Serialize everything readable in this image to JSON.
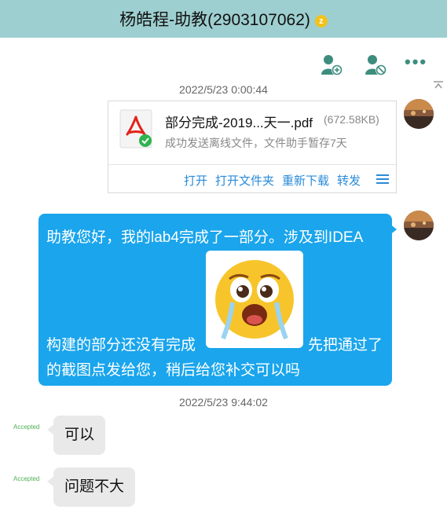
{
  "header": {
    "title": "杨皓程-助教(2903107062)",
    "badge_letter": "z",
    "background_color": "#9ecfd0"
  },
  "toolbar": {
    "icons": [
      "add-contact-icon",
      "block-contact-icon",
      "more-icon"
    ],
    "more_glyph": "•••"
  },
  "messages": [
    {
      "timestamp": "2022/5/23 0:00:44"
    },
    {
      "type": "file",
      "sender": "me",
      "file_name": "部分完成-2019...天一.pdf",
      "file_size": "(672.58KB)",
      "status": "成功发送离线文件，文件助手暂存7天",
      "actions": [
        "打开",
        "打开文件夹",
        "重新下载",
        "转发"
      ]
    },
    {
      "type": "text",
      "sender": "me",
      "lines": [
        "助教您好，我的lab4完成了一部分。涉及到IDEA",
        "构建的部分还没有完成",
        "先把通过了",
        "的截图点发给您，稍后给您补交可以吗"
      ],
      "emoji": "crying-face-sticker"
    },
    {
      "timestamp": "2022/5/23 9:44:02"
    },
    {
      "type": "text",
      "sender": "other",
      "status": "Accepted",
      "text": "可以"
    },
    {
      "type": "text",
      "sender": "other",
      "status": "Accepted",
      "text": "问题不大"
    }
  ],
  "colors": {
    "my_bubble": "#1aa5ec",
    "other_bubble": "#e9e9e9",
    "link": "#2a8bd8",
    "accepted": "#4caf50",
    "icon": "#3d8d7f"
  }
}
